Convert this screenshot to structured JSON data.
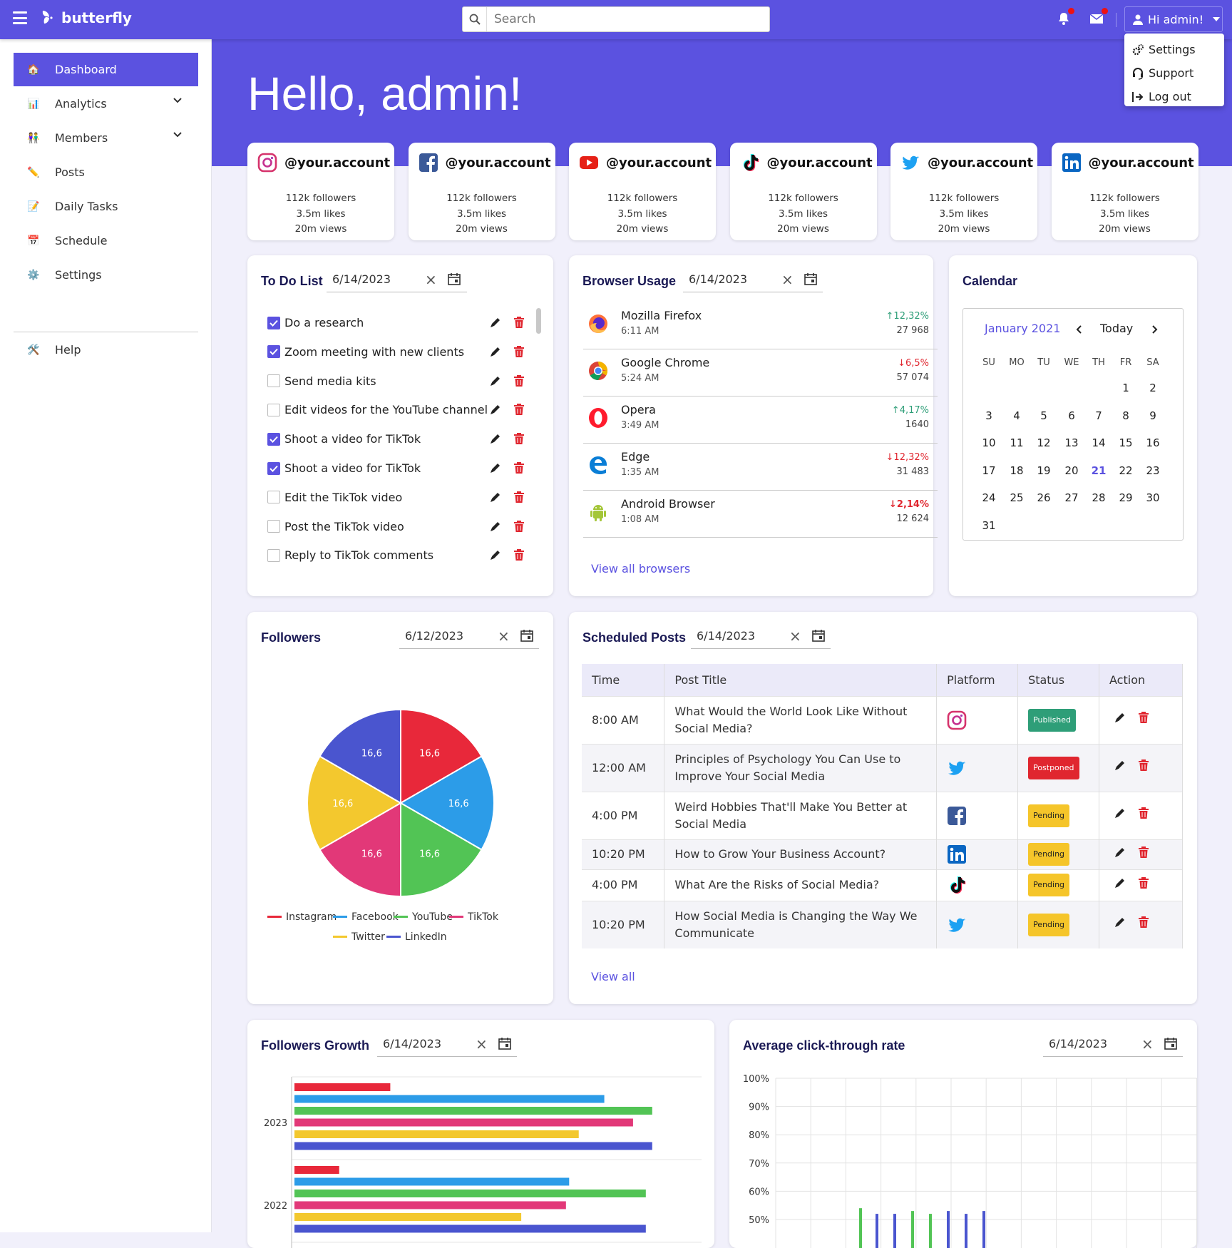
{
  "app": {
    "name": "butterfly",
    "search_placeholder": "Search",
    "user_label": "Hi admin!"
  },
  "user_menu": [
    {
      "label": "Settings",
      "icon": "gears-icon"
    },
    {
      "label": "Support",
      "icon": "headset-icon"
    },
    {
      "label": "Log out",
      "icon": "logout-icon"
    }
  ],
  "sidebar": {
    "items": [
      {
        "label": "Dashboard",
        "icon": "house-icon",
        "active": true
      },
      {
        "label": "Analytics",
        "icon": "bar-chart-icon",
        "expandable": true
      },
      {
        "label": "Members",
        "icon": "people-icon",
        "expandable": true
      },
      {
        "label": "Posts",
        "icon": "pencil-icon"
      },
      {
        "label": "Daily Tasks",
        "icon": "memo-icon"
      },
      {
        "label": "Schedule",
        "icon": "calendar-icon"
      },
      {
        "label": "Settings",
        "icon": "gear-icon"
      },
      {
        "label": "Help",
        "icon": "tools-icon"
      }
    ]
  },
  "hero": {
    "greeting": "Hello, admin!"
  },
  "social_accounts": [
    {
      "platform": "instagram",
      "handle": "@your.account",
      "followers": "112k followers",
      "likes": "3.5m likes",
      "views": "20m views"
    },
    {
      "platform": "facebook",
      "handle": "@your.account",
      "followers": "112k followers",
      "likes": "3.5m likes",
      "views": "20m views"
    },
    {
      "platform": "youtube",
      "handle": "@your.account",
      "followers": "112k followers",
      "likes": "3.5m likes",
      "views": "20m views"
    },
    {
      "platform": "tiktok",
      "handle": "@your.account",
      "followers": "112k followers",
      "likes": "3.5m likes",
      "views": "20m views"
    },
    {
      "platform": "twitter",
      "handle": "@your.account",
      "followers": "112k followers",
      "likes": "3.5m likes",
      "views": "20m views"
    },
    {
      "platform": "linkedin",
      "handle": "@your.account",
      "followers": "112k followers",
      "likes": "3.5m likes",
      "views": "20m views"
    }
  ],
  "todo": {
    "title": "To Do List",
    "date": "6/14/2023",
    "items": [
      {
        "text": "Do a research",
        "done": true
      },
      {
        "text": "Zoom meeting with new clients",
        "done": true
      },
      {
        "text": "Send media kits",
        "done": false
      },
      {
        "text": "Edit videos for the YouTube channel",
        "done": false
      },
      {
        "text": "Shoot a video for TikTok",
        "done": true
      },
      {
        "text": "Shoot a video for TikTok",
        "done": true
      },
      {
        "text": "Edit the TikTok video",
        "done": false
      },
      {
        "text": "Post the TikTok video",
        "done": false
      },
      {
        "text": "Reply to TikTok comments",
        "done": false
      }
    ]
  },
  "browser": {
    "title": "Browser Usage",
    "date": "6/14/2023",
    "view_all": "View all browsers",
    "rows": [
      {
        "name": "Mozilla Firefox",
        "time": "6:11 AM",
        "pct": "↑12,32%",
        "trend": "up",
        "value": "27 968"
      },
      {
        "name": "Google Chrome",
        "time": "5:24 AM",
        "pct": "↓6,5%",
        "trend": "down",
        "value": "57 074"
      },
      {
        "name": "Opera",
        "time": "3:49 AM",
        "pct": "↑4,17%",
        "trend": "up",
        "value": "1640"
      },
      {
        "name": "Edge",
        "time": "1:35 AM",
        "pct": "↓12,32%",
        "trend": "down",
        "value": "31 483"
      },
      {
        "name": "Android Browser",
        "time": "1:08 AM",
        "pct": "↓2,14%",
        "trend": "down",
        "value": "12 624"
      }
    ]
  },
  "calendar": {
    "title": "Calendar",
    "month": "January 2021",
    "today": "Today",
    "weekdays": [
      "SU",
      "MO",
      "TU",
      "WE",
      "TH",
      "FR",
      "SA"
    ],
    "first_weekday": 5,
    "days": 31,
    "selected": 21
  },
  "followers": {
    "title": "Followers",
    "date": "6/12/2023"
  },
  "scheduled": {
    "title": "Scheduled Posts",
    "date": "6/14/2023",
    "view_all": "View all",
    "columns": [
      "Time",
      "Post Title",
      "Platform",
      "Status",
      "Action"
    ],
    "rows": [
      {
        "time": "8:00 AM",
        "title": "What Would the World Look Like Without Social Media?",
        "platform": "instagram",
        "status": "Published"
      },
      {
        "time": "12:00 AM",
        "title": "Principles of Psychology You Can Use to Improve Your Social Media",
        "platform": "twitter",
        "status": "Postponed"
      },
      {
        "time": "4:00 PM",
        "title": "Weird Hobbies That'll Make You Better at Social Media",
        "platform": "facebook",
        "status": "Pending"
      },
      {
        "time": "10:20 PM",
        "title": "How to Grow Your Business Account?",
        "platform": "linkedin",
        "status": "Pending"
      },
      {
        "time": "4:00 PM",
        "title": "What Are the Risks of Social Media?",
        "platform": "tiktok",
        "status": "Pending"
      },
      {
        "time": "10:20 PM",
        "title": "How Social Media is Changing the Way We Communicate",
        "platform": "twitter",
        "status": "Pending"
      }
    ]
  },
  "growth": {
    "title": "Followers Growth",
    "date": "6/14/2023"
  },
  "ctr": {
    "title": "Average click-through rate",
    "date": "6/14/2023"
  },
  "colors": {
    "accent": "#5b52e0",
    "instagram": "#e8283a",
    "facebook": "#2c9ce8",
    "youtube": "#52c455",
    "tiktok": "#e23878",
    "twitter": "#f3c82e",
    "linkedin": "#4a55cf"
  },
  "chart_data": [
    {
      "type": "pie",
      "title": "Followers",
      "categories": [
        "Instagram",
        "Facebook",
        "YouTube",
        "TikTok",
        "Twitter",
        "LinkedIn"
      ],
      "values": [
        16.6,
        16.6,
        16.6,
        16.6,
        16.6,
        16.6
      ],
      "labels": [
        "16,6",
        "16,6",
        "16,6",
        "16,6",
        "16,6",
        "16,6"
      ]
    },
    {
      "type": "bar",
      "orientation": "horizontal",
      "title": "Followers Growth",
      "categories": [
        "2023",
        "2022"
      ],
      "series": [
        {
          "name": "Instagram",
          "values": [
            30,
            14
          ]
        },
        {
          "name": "Facebook",
          "values": [
            97,
            86
          ]
        },
        {
          "name": "YouTube",
          "values": [
            112,
            110
          ]
        },
        {
          "name": "TikTok",
          "values": [
            106,
            85
          ]
        },
        {
          "name": "Twitter",
          "values": [
            89,
            71
          ]
        },
        {
          "name": "LinkedIn",
          "values": [
            112,
            110
          ]
        }
      ],
      "xlim": [
        0,
        120
      ],
      "grid": true
    },
    {
      "type": "bar",
      "title": "Average click-through rate",
      "y_ticks": [
        "100%",
        "90%",
        "80%",
        "70%",
        "60%",
        "50%"
      ],
      "ylim": [
        50,
        100
      ],
      "grid": true,
      "visible_values": [
        54,
        52,
        52,
        53,
        52,
        53,
        52,
        53
      ]
    }
  ]
}
